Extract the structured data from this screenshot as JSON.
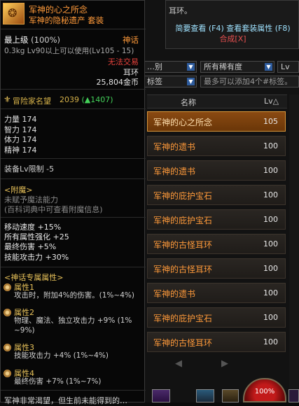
{
  "auction": {
    "tooltip_head": "耳环。",
    "tooltip_line1": "简要查看 (F4) 查看套装属性 (F8)",
    "tooltip_line2": "合成[X]",
    "filter_type": "…别",
    "filter_rarity": "所有稀有度",
    "filter_level": "Lv",
    "tag_filter": "标签",
    "tag_hint": "最多可以添加4个#标签。",
    "col_name": "名称",
    "col_lv": "Lv△",
    "rows": [
      {
        "name": "军神的心之所念",
        "lv": "105"
      },
      {
        "name": "军神的遗书",
        "lv": "100"
      },
      {
        "name": "军神的遗书",
        "lv": "100"
      },
      {
        "name": "军神的庇护宝石",
        "lv": "100"
      },
      {
        "name": "军神的庇护宝石",
        "lv": "100"
      },
      {
        "name": "军神的古怪耳环",
        "lv": "100"
      },
      {
        "name": "军神的古怪耳环",
        "lv": "100"
      },
      {
        "name": "军神的遗书",
        "lv": "100"
      },
      {
        "name": "军神的庇护宝石",
        "lv": "100"
      },
      {
        "name": "军神的古怪耳环",
        "lv": "100"
      }
    ],
    "prev": "◀",
    "next": "▶"
  },
  "item": {
    "title": "军神的心之所念",
    "subtitle": "军神的隐秘遗产  套装",
    "grade": "最上级",
    "grade_pct": "(100%)",
    "rarity": "神话",
    "weight": "0.3kg  Lv90以上可以使用(Lv105 - 15)",
    "no_trade": "无法交易",
    "type": "耳环",
    "price": "25,804金币",
    "adventurer_label": "冒险家名望",
    "adventurer_value": "2039",
    "adventurer_up": "(▲1407)",
    "stats": [
      "力量 174",
      "智力 174",
      "体力 174",
      "精神 174"
    ],
    "equip_lv": "装备Lv限制 -5",
    "enchant_title": "<附魔>",
    "enchant_a": "未赋予魔法能力",
    "enchant_b": "(百科词典中可查看附魔信息)",
    "bonus": [
      "移动速度 +15%",
      "所有属性强化 +25",
      "最终伤害 +5%",
      "技能攻击力 +30%"
    ],
    "myth_title": "<神话专属属性>",
    "attr1_name": "属性1",
    "attr1_desc": "攻击时，附加4%的伤害。(1%~4%)",
    "attr2_name": "属性2",
    "attr2_desc_a": "物理、魔法、独立攻击力 +9% (1%",
    "attr2_desc_b": "~9%)",
    "attr3_name": "属性3",
    "attr3_desc": "技能攻击力 +4% (1%~4%)",
    "attr4_name": "属性4",
    "attr4_desc": "最终伤害 +7% (1%~7%)",
    "footer": "军神非常渴望，但生前未能得到的…"
  },
  "hud": {
    "mp": "100%"
  }
}
